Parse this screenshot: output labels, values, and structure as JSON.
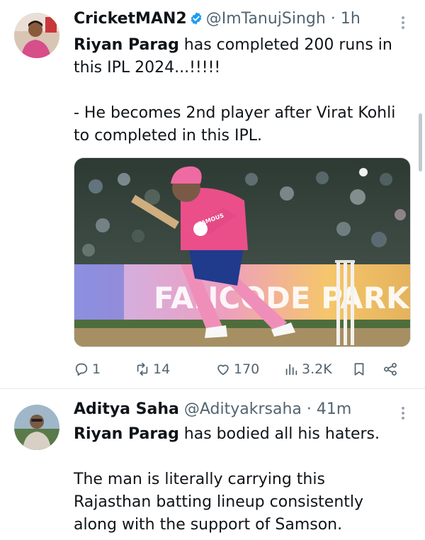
{
  "tweets": [
    {
      "display_name": "CricketMAN2",
      "handle": "@ImTanujSingh",
      "separator": "·",
      "time": "1h",
      "verified": true,
      "body_bold": "Riyan Parag",
      "body_line1_rest": " has completed 200 runs in",
      "body_line2": "this IPL 2024...!!!!!",
      "body_line3": "- He becomes 2nd player after Virat Kohli",
      "body_line4": "to completed in this IPL.",
      "media_text": "FANCODE PARK MY",
      "jersey_text": "FAMOUS",
      "stats": {
        "replies": "1",
        "retweets": "14",
        "likes": "170",
        "views": "3.2K"
      }
    },
    {
      "display_name": "Aditya Saha",
      "handle": "@Adityakrsaha",
      "separator": "·",
      "time": "41m",
      "body_bold": "Riyan Parag",
      "body_line1_rest": " has bodied all his haters.",
      "body_line2": "The man is literally carrying this",
      "body_line3": "Rajasthan batting lineup consistently",
      "body_line4": "along with the support of Samson."
    }
  ],
  "colors": {
    "text": "#0f1419",
    "muted": "#536471",
    "verified_blue": "#1d9bf0",
    "divider": "#e6e9ec"
  }
}
